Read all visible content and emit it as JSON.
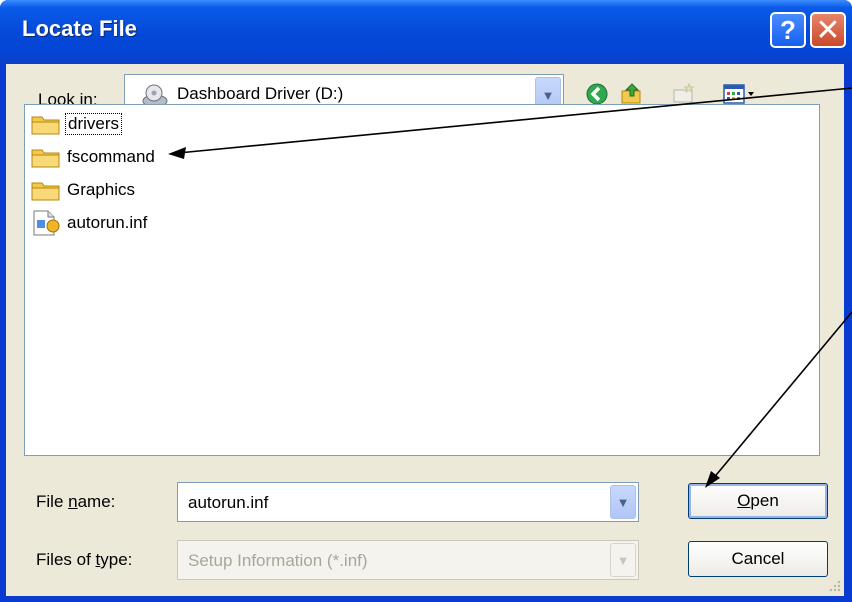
{
  "window": {
    "title": "Locate File",
    "help_label": "?",
    "close_label": "✕"
  },
  "look_in": {
    "label_prefix": "Look ",
    "label_mnemonic": "i",
    "label_suffix": "n:",
    "value": "Dashboard Driver (D:)",
    "icon": "drive-icon"
  },
  "toolbar": {
    "icons": [
      "back-icon",
      "up-folder-icon",
      "new-folder-icon",
      "view-menu-icon"
    ]
  },
  "files": [
    {
      "name": "drivers",
      "icon": "folder-icon"
    },
    {
      "name": "fscommand",
      "icon": "folder-icon"
    },
    {
      "name": "Graphics",
      "icon": "folder-icon"
    },
    {
      "name": "autorun.inf",
      "icon": "setup-file-icon"
    }
  ],
  "file_name": {
    "label_prefix": "File ",
    "label_mnemonic": "n",
    "label_suffix": "ame:",
    "value": "autorun.inf"
  },
  "file_type": {
    "label_prefix": "Files of ",
    "label_mnemonic": "t",
    "label_suffix": "ype:",
    "value": "Setup Information (*.inf)"
  },
  "buttons": {
    "open_mnemonic": "O",
    "open_rest": "pen",
    "cancel": "Cancel"
  },
  "colors": {
    "titlebar": "#0548d8",
    "dialog_bg": "#ece9d8",
    "folder": "#f2c94c",
    "annotation_arrow": "#000000"
  }
}
